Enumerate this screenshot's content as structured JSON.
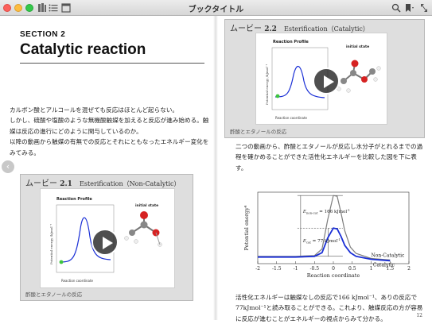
{
  "window": {
    "title": "ブックタイトル"
  },
  "toolbar": {
    "left_icons": [
      "library-icon",
      "toc-icon",
      "single-page-icon"
    ],
    "right_icons": [
      "search-icon",
      "bookmark-icon",
      "fullscreen-icon"
    ]
  },
  "colors": {
    "catalytic": "#1a2fd6",
    "non_catalytic": "#7d7d7d",
    "green_marker": "#3ec43e",
    "red_atom": "#d62222"
  },
  "left_page": {
    "section_label": "SECTION 2",
    "section_title": "Catalytic reaction",
    "paragraphs": [
      "カルボン酸とアルコールを混ぜても反応はほとんど起らない。",
      "しかし、硫酸や塩酸のような無機酸触媒を加えると反応が進み始める。触媒は反応の進行にどのように関与しているのか。",
      "以降の動画から触媒の有無での反応とそれにともなったエネルギー変化をみてみる。"
    ],
    "movie": {
      "prefix": "ムービー",
      "number": "2.1",
      "subtitle": "Esterification（Non-Catalytic）",
      "caption": "酢酸とエタノールの反応",
      "profile_title": "Reaction Profile",
      "y_axis": "Potential energy /kJmol⁻¹",
      "x_axis": "Reaction coordinate",
      "state_label": "initial state"
    }
  },
  "right_page": {
    "movie": {
      "prefix": "ムービー",
      "number": "2.2",
      "subtitle": "Esterification（Catalytic）",
      "caption": "酢酸とエタノールの反応",
      "profile_title": "Reaction Profile",
      "y_axis": "Potential energy /kJmol⁻¹",
      "x_axis": "Reaction coordinate",
      "state_label": "initial state"
    },
    "paragraph_1": "二つの動画から、酢酸とエタノールが反応し水分子がとれるまでの過程を確かめることができた活性化エネルギーを比較した図を下に表す。",
    "paragraph_2": "活性化エネルギーは触媒なしの反応で166 kJmol⁻¹、ありの反応で77kJmol⁻¹と読み取ることができる。これより、触媒反応の方が容易に反応が進むことがエネルギーの視点からみて分かる。",
    "page_number": "12"
  },
  "chart_data": {
    "type": "line",
    "xlabel": "Reaction coordinate",
    "ylabel": "Potential energy",
    "ylabel_superscript": "a",
    "xlim": [
      -2,
      2
    ],
    "x_ticks": [
      "-2",
      "-1.5",
      "-1",
      "-0.5",
      "0",
      "0.5",
      "1",
      "1.5",
      "2"
    ],
    "grid": false,
    "legend_position": "inline-right",
    "series": [
      {
        "name": "Non-Catalytic",
        "color": "#7d7d7d",
        "peak_y": 166,
        "x": [
          -2,
          -1,
          -0.5,
          -0.3,
          -0.15,
          0,
          0.1,
          0.2,
          0.3,
          0.45,
          0.6,
          1.0,
          1.5
        ],
        "y": [
          0,
          0,
          2,
          20,
          100,
          166,
          164,
          120,
          70,
          25,
          8,
          -6,
          -10
        ]
      },
      {
        "name": "Catalytic",
        "color": "#1a2fd6",
        "peak_y": 77,
        "x": [
          -2,
          -1,
          -0.5,
          -0.3,
          -0.15,
          0,
          0.1,
          0.2,
          0.3,
          0.45,
          0.6,
          1.0,
          1.5
        ],
        "y": [
          -2,
          -2,
          0,
          10,
          50,
          77,
          75,
          55,
          30,
          10,
          0,
          -8,
          -12
        ]
      }
    ],
    "annotations": [
      {
        "label_main": "E",
        "label_sub": "non-cat",
        "value_text": " = 166 kJmol",
        "unit_sup": "-1"
      },
      {
        "label_main": "E",
        "label_sub": "cat",
        "value_text": " = 77 kJmol",
        "unit_sup": "-1"
      }
    ]
  }
}
